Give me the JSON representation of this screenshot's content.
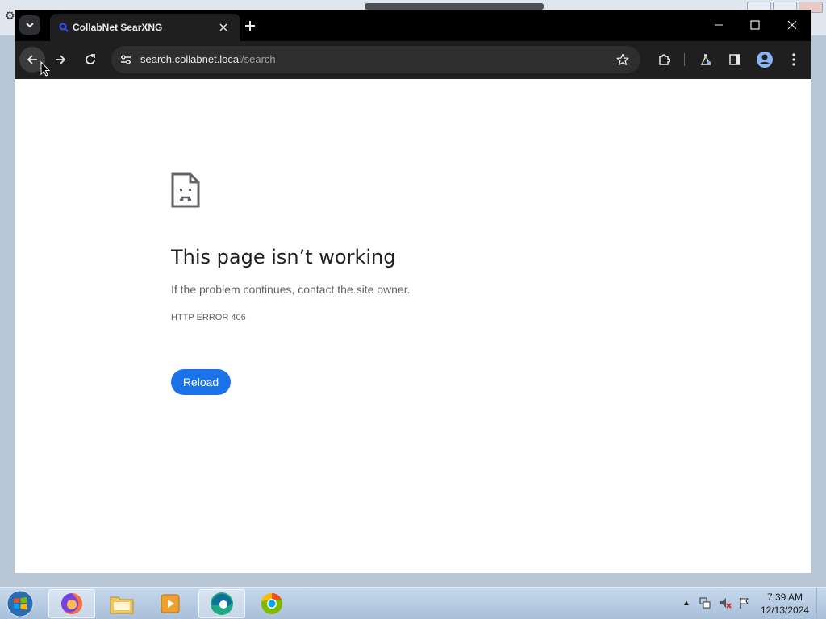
{
  "browser": {
    "tab_title": "CollabNet SearXNG",
    "url_host": "search.collabnet.local",
    "url_path": "/search"
  },
  "error_page": {
    "title": "This page isn’t working",
    "message": "If the problem continues, contact the site owner.",
    "code": "HTTP ERROR 406",
    "reload_label": "Reload"
  },
  "taskbar": {
    "apps": [
      "firefox-icon",
      "file-explorer-icon",
      "media-player-icon",
      "edge-browser-icon",
      "chrome-icon"
    ],
    "time": "7:39 AM",
    "date": "12/13/2024"
  },
  "colors": {
    "accent": "#1a73e8",
    "chrome_dark": "#1f1f1f"
  }
}
